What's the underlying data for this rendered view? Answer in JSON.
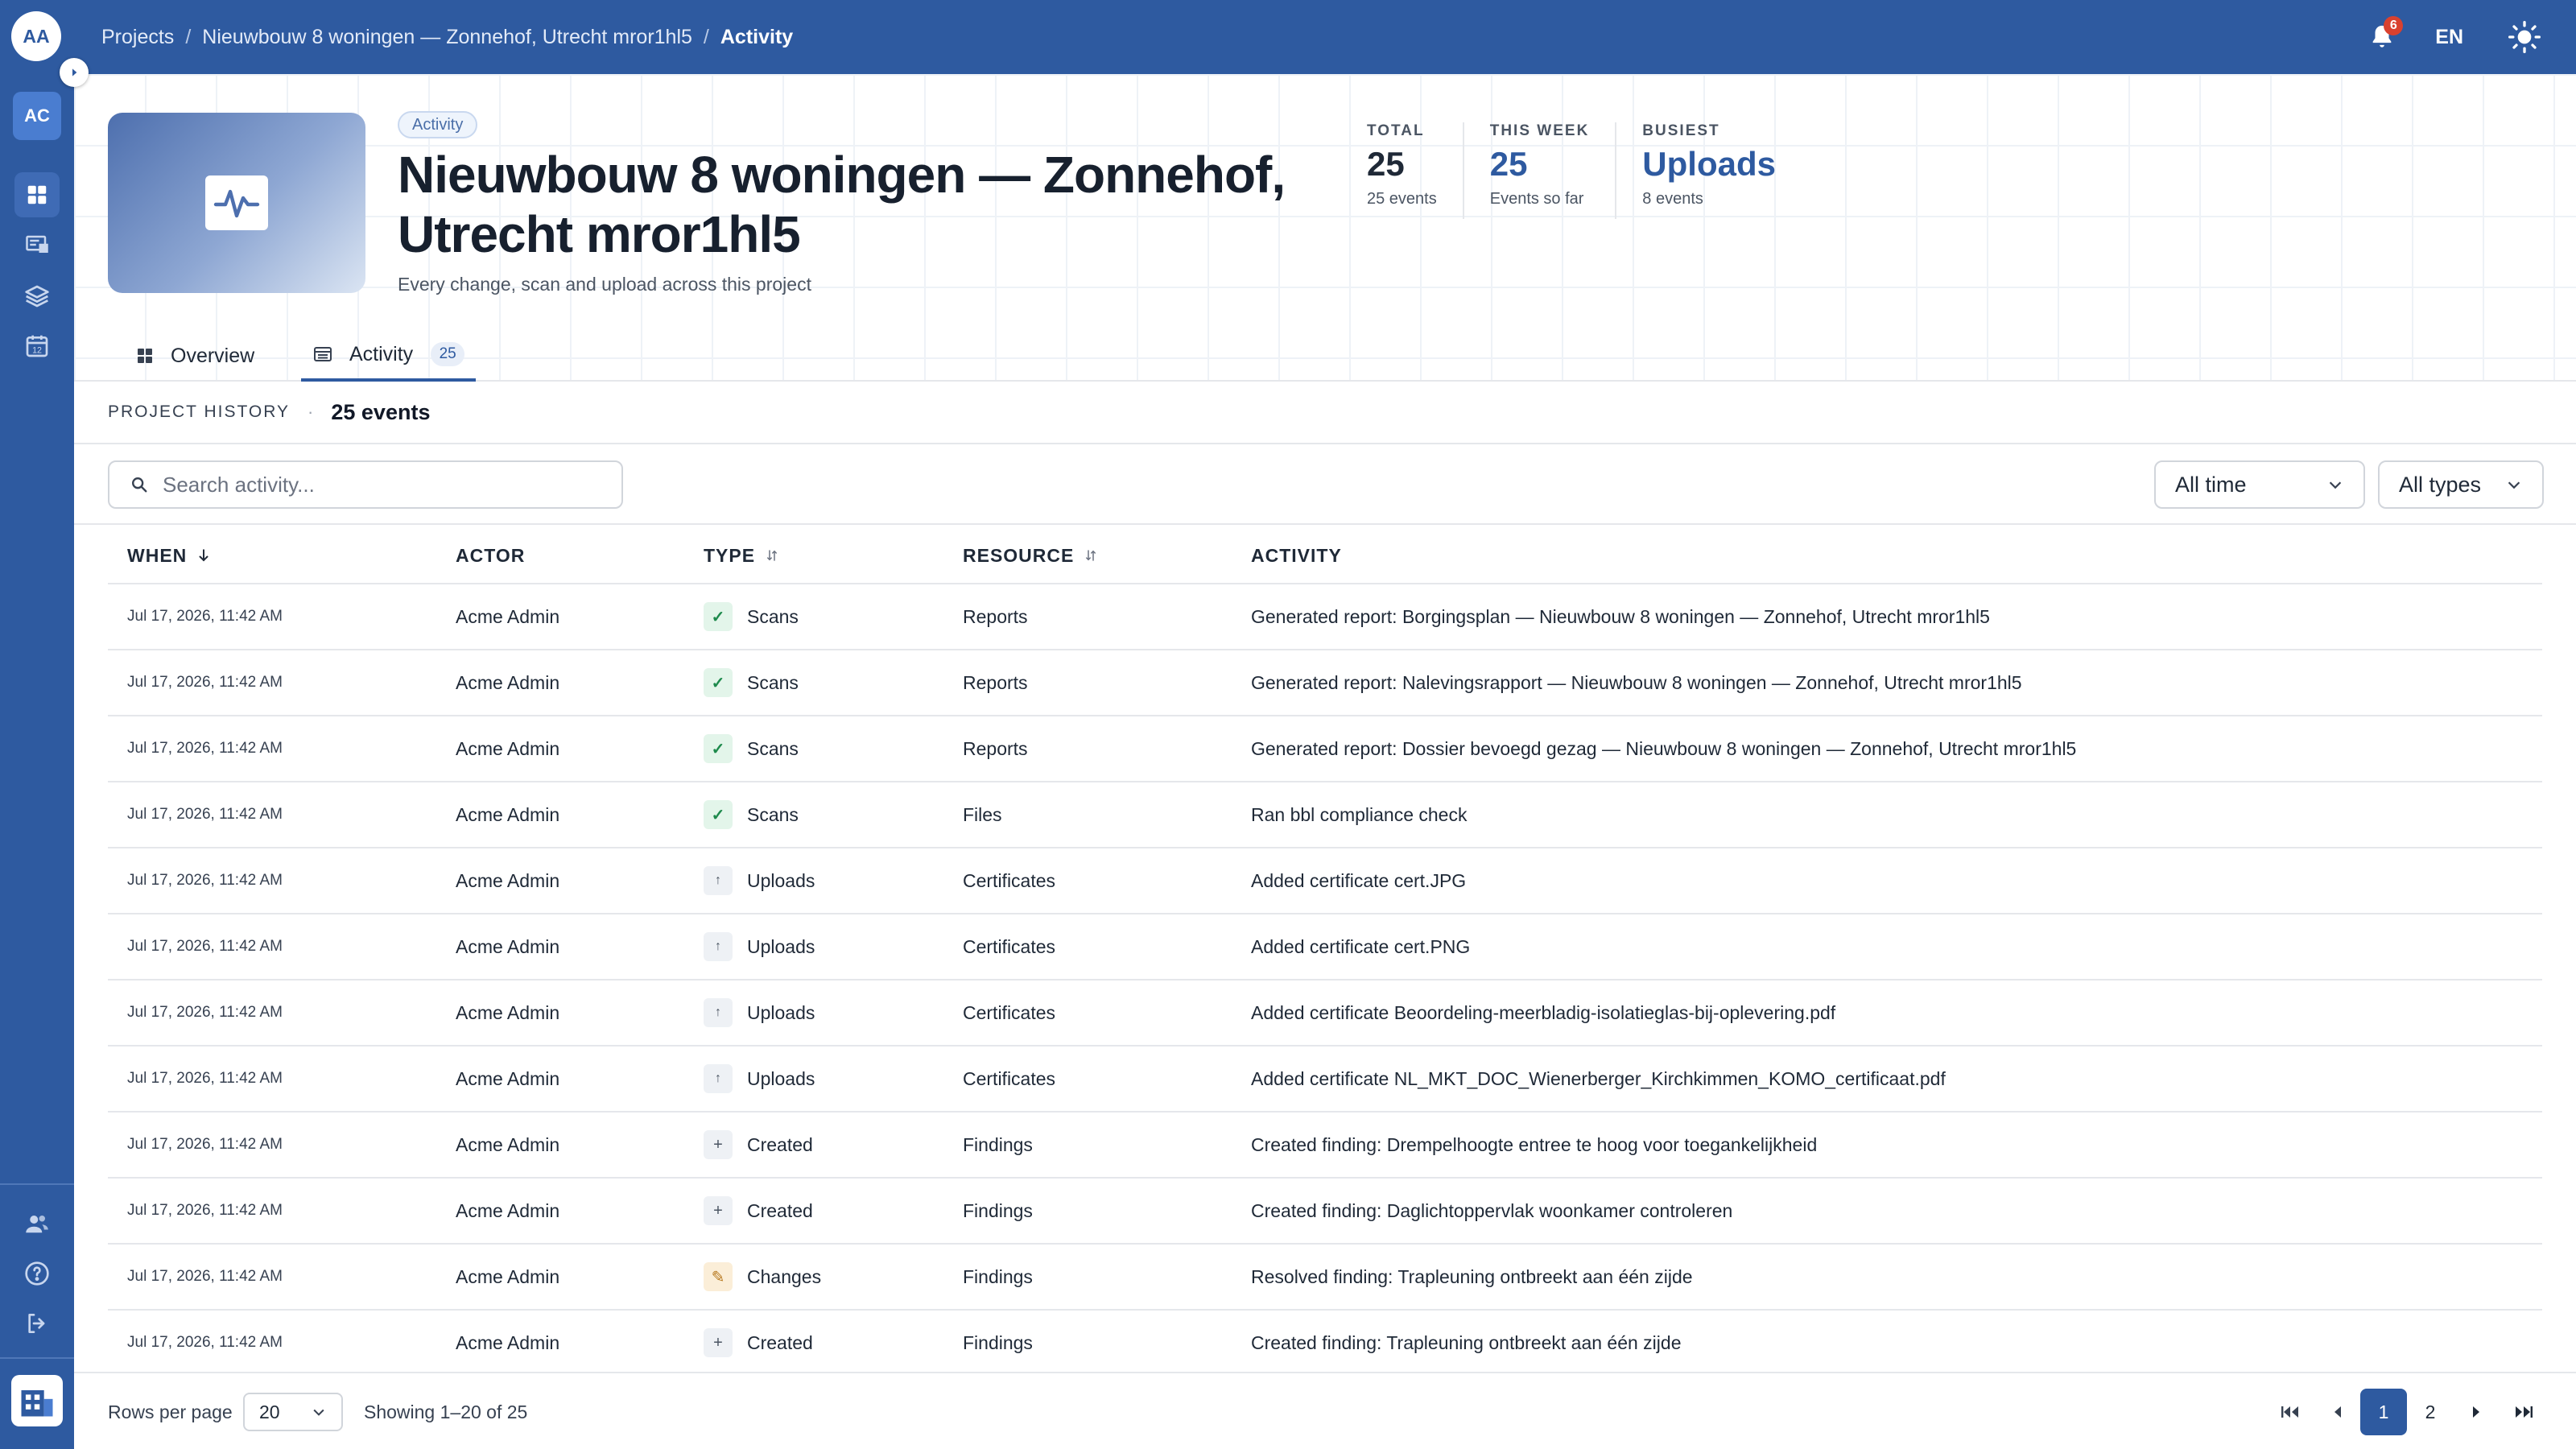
{
  "header": {
    "avatar_initials": "AA",
    "breadcrumb": [
      "Projects",
      "Nieuwbouw 8 woningen — Zonnehof, Utrecht mror1hl5",
      "Activity"
    ],
    "notifications_count": "6",
    "language": "EN"
  },
  "sidebar": {
    "org_initials": "AC",
    "icons": [
      "dashboard-icon",
      "projects-icon",
      "layers-icon",
      "calendar-icon",
      "users-icon",
      "help-icon",
      "logout-icon",
      "building-logo-icon"
    ],
    "calendar_day": "12"
  },
  "project": {
    "tag": "Activity",
    "title": "Nieuwbouw 8 woningen — Zonnehof, Utrecht mror1hl5",
    "subtitle": "Every change, scan and upload across this project"
  },
  "stats": [
    {
      "label": "TOTAL",
      "value": "25",
      "sub": "25 events"
    },
    {
      "label": "THIS WEEK",
      "value": "25",
      "sub": "Events so far"
    },
    {
      "label": "BUSIEST",
      "value": "Uploads",
      "sub": "8 events"
    }
  ],
  "tabs": [
    {
      "label": "Overview"
    },
    {
      "label": "Activity",
      "count": "25"
    }
  ],
  "history": {
    "label": "PROJECT HISTORY",
    "separator": "·",
    "count": "25 events"
  },
  "filters": {
    "search_placeholder": "Search activity...",
    "time": "All time",
    "types": "All types"
  },
  "table": {
    "columns": [
      "WHEN",
      "ACTOR",
      "TYPE",
      "RESOURCE",
      "ACTIVITY"
    ],
    "rows": [
      {
        "when": "Jul 17, 2026, 11:42 AM",
        "actor": "Acme Admin",
        "type": "Scans",
        "type_icon": "check-icon",
        "resource": "Reports",
        "activity": "Generated report: Borgingsplan — Nieuwbouw 8 woningen — Zonnehof, Utrecht mror1hl5"
      },
      {
        "when": "Jul 17, 2026, 11:42 AM",
        "actor": "Acme Admin",
        "type": "Scans",
        "type_icon": "check-icon",
        "resource": "Reports",
        "activity": "Generated report: Nalevingsrapport — Nieuwbouw 8 woningen — Zonnehof, Utrecht mror1hl5"
      },
      {
        "when": "Jul 17, 2026, 11:42 AM",
        "actor": "Acme Admin",
        "type": "Scans",
        "type_icon": "check-icon",
        "resource": "Reports",
        "activity": "Generated report: Dossier bevoegd gezag — Nieuwbouw 8 woningen — Zonnehof, Utrecht mror1hl5"
      },
      {
        "when": "Jul 17, 2026, 11:42 AM",
        "actor": "Acme Admin",
        "type": "Scans",
        "type_icon": "check-icon",
        "resource": "Files",
        "activity": "Ran bbl compliance check"
      },
      {
        "when": "Jul 17, 2026, 11:42 AM",
        "actor": "Acme Admin",
        "type": "Uploads",
        "type_icon": "upload-icon",
        "resource": "Certificates",
        "activity": "Added certificate cert.JPG"
      },
      {
        "when": "Jul 17, 2026, 11:42 AM",
        "actor": "Acme Admin",
        "type": "Uploads",
        "type_icon": "upload-icon",
        "resource": "Certificates",
        "activity": "Added certificate cert.PNG"
      },
      {
        "when": "Jul 17, 2026, 11:42 AM",
        "actor": "Acme Admin",
        "type": "Uploads",
        "type_icon": "upload-icon",
        "resource": "Certificates",
        "activity": "Added certificate Beoordeling-meerbladig-isolatieglas-bij-oplevering.pdf"
      },
      {
        "when": "Jul 17, 2026, 11:42 AM",
        "actor": "Acme Admin",
        "type": "Uploads",
        "type_icon": "upload-icon",
        "resource": "Certificates",
        "activity": "Added certificate NL_MKT_DOC_Wienerberger_Kirchkimmen_KOMO_certificaat.pdf"
      },
      {
        "when": "Jul 17, 2026, 11:42 AM",
        "actor": "Acme Admin",
        "type": "Created",
        "type_icon": "plus-icon",
        "resource": "Findings",
        "activity": "Created finding: Drempelhoogte entree te hoog voor toegankelijkheid"
      },
      {
        "when": "Jul 17, 2026, 11:42 AM",
        "actor": "Acme Admin",
        "type": "Created",
        "type_icon": "plus-icon",
        "resource": "Findings",
        "activity": "Created finding: Daglichtoppervlak woonkamer controleren"
      },
      {
        "when": "Jul 17, 2026, 11:42 AM",
        "actor": "Acme Admin",
        "type": "Changes",
        "type_icon": "pencil-icon",
        "resource": "Findings",
        "activity": "Resolved finding: Trapleuning ontbreekt aan één zijde"
      },
      {
        "when": "Jul 17, 2026, 11:42 AM",
        "actor": "Acme Admin",
        "type": "Created",
        "type_icon": "plus-icon",
        "resource": "Findings",
        "activity": "Created finding: Trapleuning ontbreekt aan één zijde"
      }
    ]
  },
  "footer": {
    "rows_per_page_label": "Rows per page",
    "rows_per_page": "20",
    "showing": "Showing 1–20 of 25",
    "pages": [
      "1",
      "2"
    ],
    "current_page": "1"
  },
  "colors": {
    "primary": "#2e5aa0",
    "notification": "#d9412f",
    "scans": "#1e8a4c",
    "changes": "#b7791f"
  }
}
